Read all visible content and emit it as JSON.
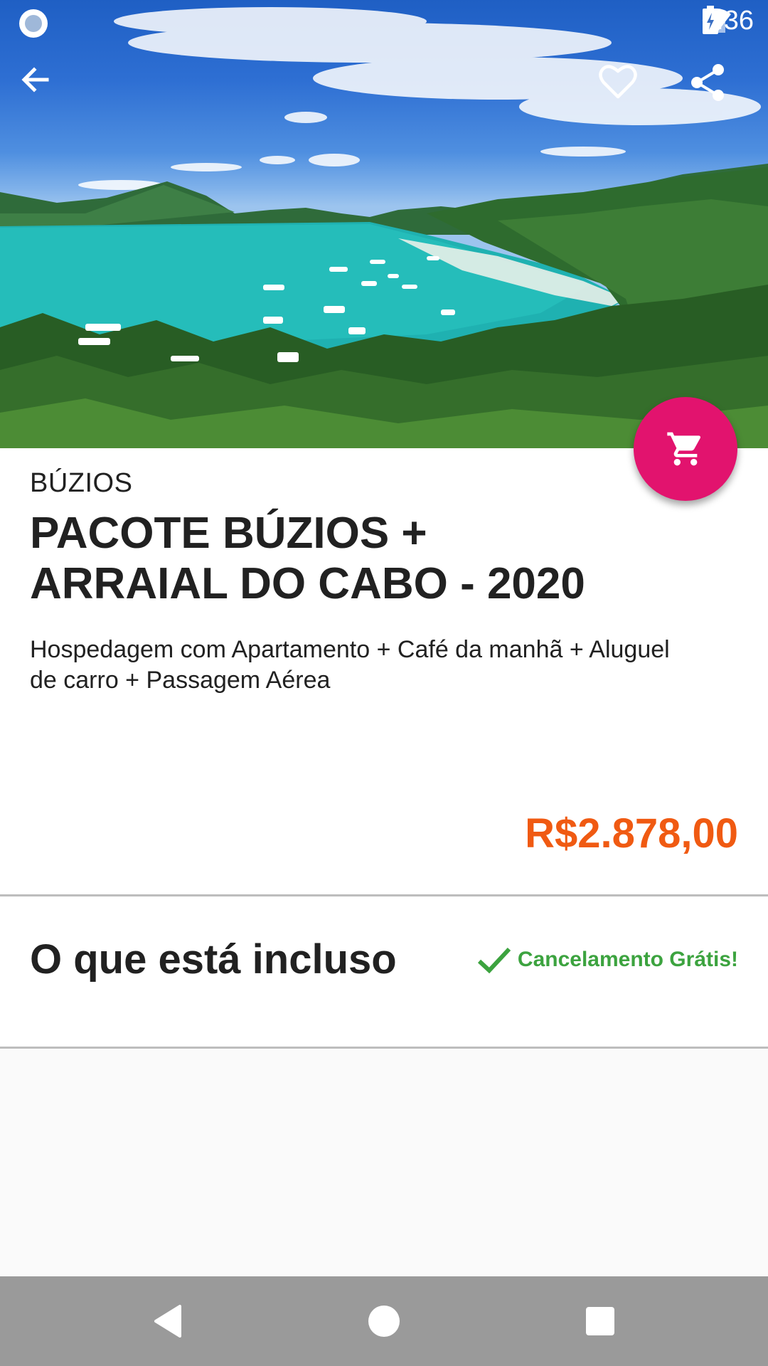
{
  "status_bar": {
    "time": "6:36",
    "icons": [
      "app-notification-icon",
      "circle-notification-icon",
      "wifi-icon",
      "signal-icon",
      "battery-charging-icon"
    ]
  },
  "app_bar": {
    "back_icon": "arrow-back-icon",
    "favorite_icon": "heart-outline-icon",
    "share_icon": "share-icon"
  },
  "fab": {
    "icon": "cart-icon",
    "color": "#e2136e"
  },
  "package": {
    "city": "BÚZIOS",
    "title": "PACOTE BÚZIOS + ARRAIAL DO CABO - 2020",
    "description": "Hospedagem com Apartamento + Café da manhã + Aluguel de carro + Passagem Aérea",
    "price": "R$2.878,00",
    "price_color": "#f05a12"
  },
  "included": {
    "title": "O que está incluso",
    "cancel_label": "Cancelamento Grátis!",
    "cancel_color": "#3ca33f"
  },
  "nav_bar": {
    "icons": [
      "nav-back-icon",
      "nav-home-icon",
      "nav-recents-icon"
    ]
  }
}
